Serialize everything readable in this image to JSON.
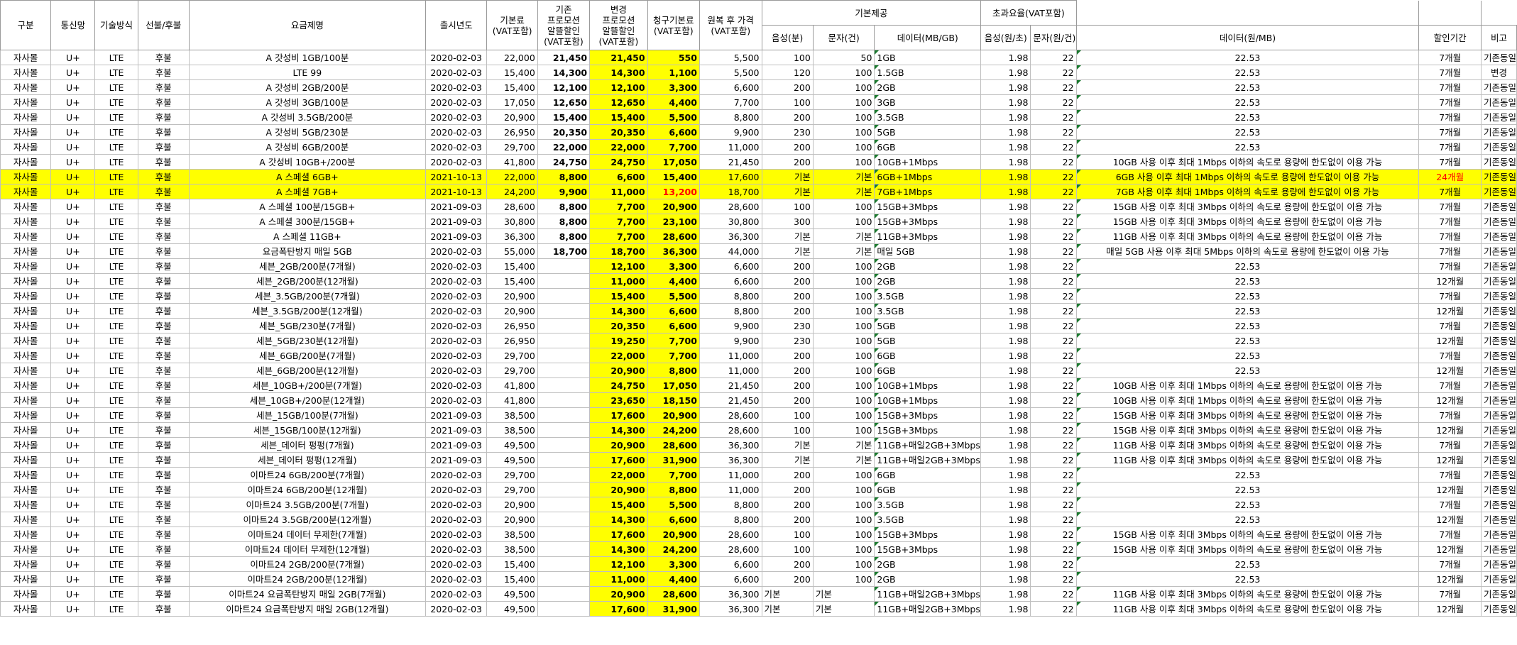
{
  "headers": {
    "gubun": "구분",
    "network": "통신망",
    "tech": "기술방식",
    "paytype": "선불/후불",
    "planname": "요금제명",
    "year": "출시년도",
    "basefee": "기본료\n(VAT포함)",
    "prev_promo": "기존\n프로모션\n알뜰할인\n(VAT포함)",
    "new_promo": "변경\n프로모션\n알뜰할인\n(VAT포함)",
    "billed": "청구기본료\n(VAT포함)",
    "restore": "원복 후 가격\n(VAT포함)",
    "basic_group": "기본제공",
    "voice": "음성(분)",
    "sms": "문자(건)",
    "data": "데이터(MB/GB)",
    "over_group": "초과요율(VAT포함)",
    "voice_rate": "음성(원/초)",
    "sms_rate": "문자(원/건)",
    "data_rate": "데이터(원/MB)",
    "period": "할인기간",
    "note": "비고"
  },
  "rows": [
    {
      "g": "자사몰",
      "n": "U+",
      "t": "LTE",
      "p": "후불",
      "name": "A 갓성비 1GB/100분",
      "y": "2020-02-03",
      "base": "22,000",
      "prev": "21,450",
      "new": "21,450",
      "bill": "550",
      "rest": "5,500",
      "voice": "100",
      "sms": "50",
      "data": "1GB",
      "vr": "1.98",
      "sr": "22",
      "dr": "22.53",
      "per": "7개월",
      "note": "기존동일",
      "hl": false
    },
    {
      "g": "자사몰",
      "n": "U+",
      "t": "LTE",
      "p": "후불",
      "name": "LTE 99",
      "y": "2020-02-03",
      "base": "15,400",
      "prev": "14,300",
      "new": "14,300",
      "bill": "1,100",
      "rest": "5,500",
      "voice": "120",
      "sms": "100",
      "data": "1.5GB",
      "vr": "1.98",
      "sr": "22",
      "dr": "22.53",
      "per": "7개월",
      "note": "변경",
      "hl": false
    },
    {
      "g": "자사몰",
      "n": "U+",
      "t": "LTE",
      "p": "후불",
      "name": "A 갓성비 2GB/200분",
      "y": "2020-02-03",
      "base": "15,400",
      "prev": "12,100",
      "new": "12,100",
      "bill": "3,300",
      "rest": "6,600",
      "voice": "200",
      "sms": "100",
      "data": "2GB",
      "vr": "1.98",
      "sr": "22",
      "dr": "22.53",
      "per": "7개월",
      "note": "기존동일",
      "hl": false
    },
    {
      "g": "자사몰",
      "n": "U+",
      "t": "LTE",
      "p": "후불",
      "name": "A 갓성비 3GB/100분",
      "y": "2020-02-03",
      "base": "17,050",
      "prev": "12,650",
      "new": "12,650",
      "bill": "4,400",
      "rest": "7,700",
      "voice": "100",
      "sms": "100",
      "data": "3GB",
      "vr": "1.98",
      "sr": "22",
      "dr": "22.53",
      "per": "7개월",
      "note": "기존동일",
      "hl": false
    },
    {
      "g": "자사몰",
      "n": "U+",
      "t": "LTE",
      "p": "후불",
      "name": "A 갓성비 3.5GB/200분",
      "y": "2020-02-03",
      "base": "20,900",
      "prev": "15,400",
      "new": "15,400",
      "bill": "5,500",
      "rest": "8,800",
      "voice": "200",
      "sms": "100",
      "data": "3.5GB",
      "vr": "1.98",
      "sr": "22",
      "dr": "22.53",
      "per": "7개월",
      "note": "기존동일",
      "hl": false
    },
    {
      "g": "자사몰",
      "n": "U+",
      "t": "LTE",
      "p": "후불",
      "name": "A 갓성비 5GB/230분",
      "y": "2020-02-03",
      "base": "26,950",
      "prev": "20,350",
      "new": "20,350",
      "bill": "6,600",
      "rest": "9,900",
      "voice": "230",
      "sms": "100",
      "data": "5GB",
      "vr": "1.98",
      "sr": "22",
      "dr": "22.53",
      "per": "7개월",
      "note": "기존동일",
      "hl": false
    },
    {
      "g": "자사몰",
      "n": "U+",
      "t": "LTE",
      "p": "후불",
      "name": "A 갓성비 6GB/200분",
      "y": "2020-02-03",
      "base": "29,700",
      "prev": "22,000",
      "new": "22,000",
      "bill": "7,700",
      "rest": "11,000",
      "voice": "200",
      "sms": "100",
      "data": "6GB",
      "vr": "1.98",
      "sr": "22",
      "dr": "22.53",
      "per": "7개월",
      "note": "기존동일",
      "hl": false
    },
    {
      "g": "자사몰",
      "n": "U+",
      "t": "LTE",
      "p": "후불",
      "name": "A 갓성비 10GB+/200분",
      "y": "2020-02-03",
      "base": "41,800",
      "prev": "24,750",
      "new": "24,750",
      "bill": "17,050",
      "rest": "21,450",
      "voice": "200",
      "sms": "100",
      "data": "10GB+1Mbps",
      "vr": "1.98",
      "sr": "22",
      "dr": "10GB 사용 이후 최대 1Mbps 이하의 속도로 용량에 한도없이 이용 가능",
      "per": "7개월",
      "note": "기존동일",
      "hl": false
    },
    {
      "g": "자사몰",
      "n": "U+",
      "t": "LTE",
      "p": "후불",
      "name": "A 스페셜 6GB+",
      "y": "2021-10-13",
      "base": "22,000",
      "prev": "8,800",
      "new": "6,600",
      "bill": "15,400",
      "rest": "17,600",
      "voice": "기본",
      "sms": "기본",
      "data": "6GB+1Mbps",
      "vr": "1.98",
      "sr": "22",
      "dr": "6GB 사용 이후 최대 1Mbps 이하의 속도로 용량에 한도없이 이용 가능",
      "per": "24개월",
      "note": "기존동일",
      "hl": true,
      "perRed": true
    },
    {
      "g": "자사몰",
      "n": "U+",
      "t": "LTE",
      "p": "후불",
      "name": "A 스페셜 7GB+",
      "y": "2021-10-13",
      "base": "24,200",
      "prev": "9,900",
      "new": "11,000",
      "bill": "13,200",
      "rest": "18,700",
      "voice": "기본",
      "sms": "기본",
      "data": "7GB+1Mbps",
      "vr": "1.98",
      "sr": "22",
      "dr": "7GB 사용 이후 최대 1Mbps 이하의 속도로 용량에 한도없이 이용 가능",
      "per": "7개월",
      "note": "기존동일",
      "hl": true,
      "billRed": true
    },
    {
      "g": "자사몰",
      "n": "U+",
      "t": "LTE",
      "p": "후불",
      "name": "A 스페셜 100분/15GB+",
      "y": "2021-09-03",
      "base": "28,600",
      "prev": "8,800",
      "new": "7,700",
      "bill": "20,900",
      "rest": "28,600",
      "voice": "100",
      "sms": "100",
      "data": "15GB+3Mbps",
      "vr": "1.98",
      "sr": "22",
      "dr": "15GB 사용 이후 최대 3Mbps 이하의 속도로 용량에 한도없이 이용 가능",
      "per": "7개월",
      "note": "기존동일",
      "hl": false
    },
    {
      "g": "자사몰",
      "n": "U+",
      "t": "LTE",
      "p": "후불",
      "name": "A 스페셜 300분/15GB+",
      "y": "2021-09-03",
      "base": "30,800",
      "prev": "8,800",
      "new": "7,700",
      "bill": "23,100",
      "rest": "30,800",
      "voice": "300",
      "sms": "100",
      "data": "15GB+3Mbps",
      "vr": "1.98",
      "sr": "22",
      "dr": "15GB 사용 이후 최대 3Mbps 이하의 속도로 용량에 한도없이 이용 가능",
      "per": "7개월",
      "note": "기존동일",
      "hl": false
    },
    {
      "g": "자사몰",
      "n": "U+",
      "t": "LTE",
      "p": "후불",
      "name": "A 스페셜 11GB+",
      "y": "2021-09-03",
      "base": "36,300",
      "prev": "8,800",
      "new": "7,700",
      "bill": "28,600",
      "rest": "36,300",
      "voice": "기본",
      "sms": "기본",
      "data": "11GB+3Mbps",
      "vr": "1.98",
      "sr": "22",
      "dr": "11GB 사용 이후 최대 3Mbps 이하의 속도로 용량에 한도없이 이용 가능",
      "per": "7개월",
      "note": "기존동일",
      "hl": false
    },
    {
      "g": "자사몰",
      "n": "U+",
      "t": "LTE",
      "p": "후불",
      "name": "요금폭탄방지 매일 5GB",
      "y": "2020-02-03",
      "base": "55,000",
      "prev": "18,700",
      "new": "18,700",
      "bill": "36,300",
      "rest": "44,000",
      "voice": "기본",
      "sms": "기본",
      "data": "매일 5GB",
      "vr": "1.98",
      "sr": "22",
      "dr": "매일 5GB 사용 이후 최대 5Mbps 이하의 속도로 용량에 한도없이 이용 가능",
      "per": "7개월",
      "note": "기존동일",
      "hl": false
    },
    {
      "g": "자사몰",
      "n": "U+",
      "t": "LTE",
      "p": "후불",
      "name": "세븐_2GB/200분(7개월)",
      "y": "2020-02-03",
      "base": "15,400",
      "prev": "",
      "new": "12,100",
      "bill": "3,300",
      "rest": "6,600",
      "voice": "200",
      "sms": "100",
      "data": "2GB",
      "vr": "1.98",
      "sr": "22",
      "dr": "22.53",
      "per": "7개월",
      "note": "기존동일",
      "hl": false
    },
    {
      "g": "자사몰",
      "n": "U+",
      "t": "LTE",
      "p": "후불",
      "name": "세븐_2GB/200분(12개월)",
      "y": "2020-02-03",
      "base": "15,400",
      "prev": "",
      "new": "11,000",
      "bill": "4,400",
      "rest": "6,600",
      "voice": "200",
      "sms": "100",
      "data": "2GB",
      "vr": "1.98",
      "sr": "22",
      "dr": "22.53",
      "per": "12개월",
      "note": "기존동일",
      "hl": false
    },
    {
      "g": "자사몰",
      "n": "U+",
      "t": "LTE",
      "p": "후불",
      "name": "세븐_3.5GB/200분(7개월)",
      "y": "2020-02-03",
      "base": "20,900",
      "prev": "",
      "new": "15,400",
      "bill": "5,500",
      "rest": "8,800",
      "voice": "200",
      "sms": "100",
      "data": "3.5GB",
      "vr": "1.98",
      "sr": "22",
      "dr": "22.53",
      "per": "7개월",
      "note": "기존동일",
      "hl": false
    },
    {
      "g": "자사몰",
      "n": "U+",
      "t": "LTE",
      "p": "후불",
      "name": "세븐_3.5GB/200분(12개월)",
      "y": "2020-02-03",
      "base": "20,900",
      "prev": "",
      "new": "14,300",
      "bill": "6,600",
      "rest": "8,800",
      "voice": "200",
      "sms": "100",
      "data": "3.5GB",
      "vr": "1.98",
      "sr": "22",
      "dr": "22.53",
      "per": "12개월",
      "note": "기존동일",
      "hl": false
    },
    {
      "g": "자사몰",
      "n": "U+",
      "t": "LTE",
      "p": "후불",
      "name": "세븐_5GB/230분(7개월)",
      "y": "2020-02-03",
      "base": "26,950",
      "prev": "",
      "new": "20,350",
      "bill": "6,600",
      "rest": "9,900",
      "voice": "230",
      "sms": "100",
      "data": "5GB",
      "vr": "1.98",
      "sr": "22",
      "dr": "22.53",
      "per": "7개월",
      "note": "기존동일",
      "hl": false
    },
    {
      "g": "자사몰",
      "n": "U+",
      "t": "LTE",
      "p": "후불",
      "name": "세븐_5GB/230분(12개월)",
      "y": "2020-02-03",
      "base": "26,950",
      "prev": "",
      "new": "19,250",
      "bill": "7,700",
      "rest": "9,900",
      "voice": "230",
      "sms": "100",
      "data": "5GB",
      "vr": "1.98",
      "sr": "22",
      "dr": "22.53",
      "per": "12개월",
      "note": "기존동일",
      "hl": false
    },
    {
      "g": "자사몰",
      "n": "U+",
      "t": "LTE",
      "p": "후불",
      "name": "세븐_6GB/200분(7개월)",
      "y": "2020-02-03",
      "base": "29,700",
      "prev": "",
      "new": "22,000",
      "bill": "7,700",
      "rest": "11,000",
      "voice": "200",
      "sms": "100",
      "data": "6GB",
      "vr": "1.98",
      "sr": "22",
      "dr": "22.53",
      "per": "7개월",
      "note": "기존동일",
      "hl": false
    },
    {
      "g": "자사몰",
      "n": "U+",
      "t": "LTE",
      "p": "후불",
      "name": "세븐_6GB/200분(12개월)",
      "y": "2020-02-03",
      "base": "29,700",
      "prev": "",
      "new": "20,900",
      "bill": "8,800",
      "rest": "11,000",
      "voice": "200",
      "sms": "100",
      "data": "6GB",
      "vr": "1.98",
      "sr": "22",
      "dr": "22.53",
      "per": "12개월",
      "note": "기존동일",
      "hl": false
    },
    {
      "g": "자사몰",
      "n": "U+",
      "t": "LTE",
      "p": "후불",
      "name": "세븐_10GB+/200분(7개월)",
      "y": "2020-02-03",
      "base": "41,800",
      "prev": "",
      "new": "24,750",
      "bill": "17,050",
      "rest": "21,450",
      "voice": "200",
      "sms": "100",
      "data": "10GB+1Mbps",
      "vr": "1.98",
      "sr": "22",
      "dr": "10GB 사용 이후 최대 1Mbps 이하의 속도로 용량에 한도없이 이용 가능",
      "per": "7개월",
      "note": "기존동일",
      "hl": false
    },
    {
      "g": "자사몰",
      "n": "U+",
      "t": "LTE",
      "p": "후불",
      "name": "세븐_10GB+/200분(12개월)",
      "y": "2020-02-03",
      "base": "41,800",
      "prev": "",
      "new": "23,650",
      "bill": "18,150",
      "rest": "21,450",
      "voice": "200",
      "sms": "100",
      "data": "10GB+1Mbps",
      "vr": "1.98",
      "sr": "22",
      "dr": "10GB 사용 이후 최대 1Mbps 이하의 속도로 용량에 한도없이 이용 가능",
      "per": "12개월",
      "note": "기존동일",
      "hl": false
    },
    {
      "g": "자사몰",
      "n": "U+",
      "t": "LTE",
      "p": "후불",
      "name": "세븐_15GB/100분(7개월)",
      "y": "2021-09-03",
      "base": "38,500",
      "prev": "",
      "new": "17,600",
      "bill": "20,900",
      "rest": "28,600",
      "voice": "100",
      "sms": "100",
      "data": "15GB+3Mbps",
      "vr": "1.98",
      "sr": "22",
      "dr": "15GB 사용 이후 최대 3Mbps 이하의 속도로 용량에 한도없이 이용 가능",
      "per": "7개월",
      "note": "기존동일",
      "hl": false
    },
    {
      "g": "자사몰",
      "n": "U+",
      "t": "LTE",
      "p": "후불",
      "name": "세븐_15GB/100분(12개월)",
      "y": "2021-09-03",
      "base": "38,500",
      "prev": "",
      "new": "14,300",
      "bill": "24,200",
      "rest": "28,600",
      "voice": "100",
      "sms": "100",
      "data": "15GB+3Mbps",
      "vr": "1.98",
      "sr": "22",
      "dr": "15GB 사용 이후 최대 3Mbps 이하의 속도로 용량에 한도없이 이용 가능",
      "per": "12개월",
      "note": "기존동일",
      "hl": false
    },
    {
      "g": "자사몰",
      "n": "U+",
      "t": "LTE",
      "p": "후불",
      "name": "세븐_데이터 펑펑(7개월)",
      "y": "2021-09-03",
      "base": "49,500",
      "prev": "",
      "new": "20,900",
      "bill": "28,600",
      "rest": "36,300",
      "voice": "기본",
      "sms": "기본",
      "data": "11GB+매일2GB+3Mbps",
      "vr": "1.98",
      "sr": "22",
      "dr": "11GB 사용 이후 최대 3Mbps 이하의 속도로 용량에 한도없이 이용 가능",
      "per": "7개월",
      "note": "기존동일",
      "hl": false
    },
    {
      "g": "자사몰",
      "n": "U+",
      "t": "LTE",
      "p": "후불",
      "name": "세븐_데이터 펑펑(12개월)",
      "y": "2021-09-03",
      "base": "49,500",
      "prev": "",
      "new": "17,600",
      "bill": "31,900",
      "rest": "36,300",
      "voice": "기본",
      "sms": "기본",
      "data": "11GB+매일2GB+3Mbps",
      "vr": "1.98",
      "sr": "22",
      "dr": "11GB 사용 이후 최대 3Mbps 이하의 속도로 용량에 한도없이 이용 가능",
      "per": "12개월",
      "note": "기존동일",
      "hl": false
    },
    {
      "g": "자사몰",
      "n": "U+",
      "t": "LTE",
      "p": "후불",
      "name": "이마트24 6GB/200분(7개월)",
      "y": "2020-02-03",
      "base": "29,700",
      "prev": "",
      "new": "22,000",
      "bill": "7,700",
      "rest": "11,000",
      "voice": "200",
      "sms": "100",
      "data": "6GB",
      "vr": "1.98",
      "sr": "22",
      "dr": "22.53",
      "per": "7개월",
      "note": "기존동일",
      "hl": false
    },
    {
      "g": "자사몰",
      "n": "U+",
      "t": "LTE",
      "p": "후불",
      "name": "이마트24 6GB/200분(12개월)",
      "y": "2020-02-03",
      "base": "29,700",
      "prev": "",
      "new": "20,900",
      "bill": "8,800",
      "rest": "11,000",
      "voice": "200",
      "sms": "100",
      "data": "6GB",
      "vr": "1.98",
      "sr": "22",
      "dr": "22.53",
      "per": "12개월",
      "note": "기존동일",
      "hl": false
    },
    {
      "g": "자사몰",
      "n": "U+",
      "t": "LTE",
      "p": "후불",
      "name": "이마트24 3.5GB/200분(7개월)",
      "y": "2020-02-03",
      "base": "20,900",
      "prev": "",
      "new": "15,400",
      "bill": "5,500",
      "rest": "8,800",
      "voice": "200",
      "sms": "100",
      "data": "3.5GB",
      "vr": "1.98",
      "sr": "22",
      "dr": "22.53",
      "per": "7개월",
      "note": "기존동일",
      "hl": false
    },
    {
      "g": "자사몰",
      "n": "U+",
      "t": "LTE",
      "p": "후불",
      "name": "이마트24 3.5GB/200분(12개월)",
      "y": "2020-02-03",
      "base": "20,900",
      "prev": "",
      "new": "14,300",
      "bill": "6,600",
      "rest": "8,800",
      "voice": "200",
      "sms": "100",
      "data": "3.5GB",
      "vr": "1.98",
      "sr": "22",
      "dr": "22.53",
      "per": "12개월",
      "note": "기존동일",
      "hl": false
    },
    {
      "g": "자사몰",
      "n": "U+",
      "t": "LTE",
      "p": "후불",
      "name": "이마트24 데이터 무제한(7개월)",
      "y": "2020-02-03",
      "base": "38,500",
      "prev": "",
      "new": "17,600",
      "bill": "20,900",
      "rest": "28,600",
      "voice": "100",
      "sms": "100",
      "data": "15GB+3Mbps",
      "vr": "1.98",
      "sr": "22",
      "dr": "15GB 사용 이후 최대 3Mbps 이하의 속도로 용량에 한도없이 이용 가능",
      "per": "7개월",
      "note": "기존동일",
      "hl": false
    },
    {
      "g": "자사몰",
      "n": "U+",
      "t": "LTE",
      "p": "후불",
      "name": "이마트24 데이터 무제한(12개월)",
      "y": "2020-02-03",
      "base": "38,500",
      "prev": "",
      "new": "14,300",
      "bill": "24,200",
      "rest": "28,600",
      "voice": "100",
      "sms": "100",
      "data": "15GB+3Mbps",
      "vr": "1.98",
      "sr": "22",
      "dr": "15GB 사용 이후 최대 3Mbps 이하의 속도로 용량에 한도없이 이용 가능",
      "per": "12개월",
      "note": "기존동일",
      "hl": false
    },
    {
      "g": "자사몰",
      "n": "U+",
      "t": "LTE",
      "p": "후불",
      "name": "이마트24 2GB/200분(7개월)",
      "y": "2020-02-03",
      "base": "15,400",
      "prev": "",
      "new": "12,100",
      "bill": "3,300",
      "rest": "6,600",
      "voice": "200",
      "sms": "100",
      "data": "2GB",
      "vr": "1.98",
      "sr": "22",
      "dr": "22.53",
      "per": "7개월",
      "note": "기존동일",
      "hl": false
    },
    {
      "g": "자사몰",
      "n": "U+",
      "t": "LTE",
      "p": "후불",
      "name": "이마트24 2GB/200분(12개월)",
      "y": "2020-02-03",
      "base": "15,400",
      "prev": "",
      "new": "11,000",
      "bill": "4,400",
      "rest": "6,600",
      "voice": "200",
      "sms": "100",
      "data": "2GB",
      "vr": "1.98",
      "sr": "22",
      "dr": "22.53",
      "per": "12개월",
      "note": "기존동일",
      "hl": false
    },
    {
      "g": "자사몰",
      "n": "U+",
      "t": "LTE",
      "p": "후불",
      "name": "이마트24 요금폭탄방지 매일 2GB(7개월)",
      "y": "2020-02-03",
      "base": "49,500",
      "prev": "",
      "new": "20,900",
      "bill": "28,600",
      "rest": "36,300",
      "voice": "기본",
      "sms": "기본",
      "data": "11GB+매일2GB+3Mbps",
      "vr": "1.98",
      "sr": "22",
      "dr": "11GB 사용 이후 최대 3Mbps 이하의 속도로 용량에 한도없이 이용 가능",
      "per": "7개월",
      "note": "기존동일",
      "hl": false,
      "voiceLeft": true
    },
    {
      "g": "자사몰",
      "n": "U+",
      "t": "LTE",
      "p": "후불",
      "name": "이마트24 요금폭탄방지 매일 2GB(12개월)",
      "y": "2020-02-03",
      "base": "49,500",
      "prev": "",
      "new": "17,600",
      "bill": "31,900",
      "rest": "36,300",
      "voice": "기본",
      "sms": "기본",
      "data": "11GB+매일2GB+3Mbps",
      "vr": "1.98",
      "sr": "22",
      "dr": "11GB 사용 이후 최대 3Mbps 이하의 속도로 용량에 한도없이 이용 가능",
      "per": "12개월",
      "note": "기존동일",
      "hl": false,
      "voiceLeft": true
    }
  ]
}
